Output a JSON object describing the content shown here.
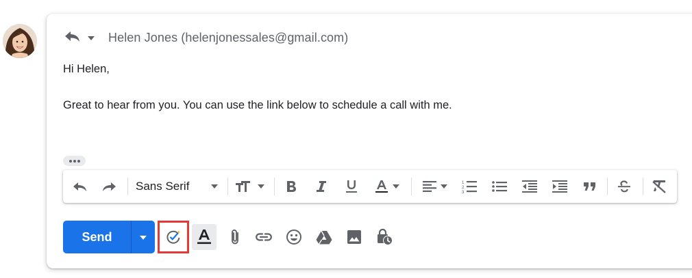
{
  "recipient": {
    "text": "Helen Jones (helenjonessales@gmail.com)"
  },
  "message": {
    "greeting": "Hi Helen,",
    "body": "Great to hear from you. You can use the link below to schedule a call with me."
  },
  "format_toolbar": {
    "font": "Sans Serif",
    "icons": [
      "undo-icon",
      "redo-icon",
      "font-size-icon",
      "bold-icon",
      "italic-icon",
      "underline-icon",
      "text-color-icon",
      "align-icon",
      "numbered-list-icon",
      "bulleted-list-icon",
      "indent-less-icon",
      "indent-more-icon",
      "quote-icon",
      "strikethrough-icon",
      "remove-formatting-icon"
    ]
  },
  "bottom_toolbar": {
    "send_label": "Send",
    "icons": [
      "scheduling-icon",
      "formatting-options-icon",
      "attach-icon",
      "link-icon",
      "emoji-icon",
      "drive-icon",
      "photo-icon",
      "confidential-mode-icon"
    ]
  },
  "colors": {
    "send": "#1a73e8",
    "icon": "#5f6368",
    "highlight": "#e53935"
  }
}
